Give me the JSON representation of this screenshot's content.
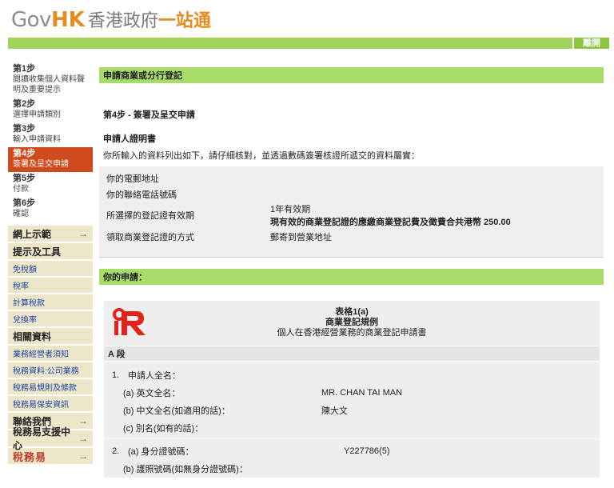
{
  "logo": {
    "gov": "Gov",
    "hk": "HK",
    "zh_part1": "香港政府",
    "zh_part2": "一站通"
  },
  "topbar": {
    "exit_label": "離開"
  },
  "steps": [
    {
      "title": "第1步",
      "desc": "閱讀收集個人資料聲明及重要提示"
    },
    {
      "title": "第2步",
      "desc": "選擇申請類別"
    },
    {
      "title": "第3步",
      "desc": "輸入申請資料"
    },
    {
      "title": "第4步",
      "desc": "簽署及呈交申請"
    },
    {
      "title": "第5步",
      "desc": "付款"
    },
    {
      "title": "第6步",
      "desc": "確認"
    }
  ],
  "side_menu": {
    "online_demo": "網上示範",
    "tips_tools": "提示及工具",
    "tips_links": [
      "免稅額",
      "稅率",
      "計算稅款",
      "兌換率"
    ],
    "related": "相關資料",
    "related_links": [
      "業務經營者須知",
      "稅務資料:公司業務",
      "稅務易規則及條款",
      "稅務易保安資訊"
    ],
    "contact": "聯絡我們",
    "support": "稅務易支援中心",
    "calligraphy": "稅務易",
    "arrow": "→"
  },
  "main": {
    "section_title": "申請商業或分行登記",
    "step_heading": "第4步 - 簽署及呈交申請",
    "declaration_heading": "申請人證明書",
    "intro_text": "你所輸入的資料列出如下，請仔細核對，並透過數碼簽署核證所遞交的資料屬實：",
    "summary": {
      "email_label": "你的電郵地址",
      "phone_label": "你的聯絡電話號碼",
      "validity_label": "所選擇的登記證有效期",
      "validity_value_line1": "1年有效期",
      "validity_value_line2": "現有效的商業登記證的應繳商業登記費及徵費合共港幣 250.00",
      "method_label": "領取商業登記證的方式",
      "method_value": "郵寄到營業地址"
    },
    "your_application": "你的申請："
  },
  "form": {
    "title1": "表格1(a)",
    "title2": "商業登記規例",
    "title3": "個人在香港經營業務的商業登記申請書",
    "section_a": "A 段",
    "q1_num": "1.",
    "q1_label": "申請人全名：",
    "q1a_label": "(a) 英文全名：",
    "q1a_value": "MR. CHAN TAI MAN",
    "q1b_label": "(b) 中文全名(如適用的話)：",
    "q1b_value": "陳大文",
    "q1c_label": "(c) 別名(如有的話)：",
    "q2_num": "2.",
    "q2a_label": "(a) 身分證號碼：",
    "q2a_value": "Y227786(5)",
    "q2b_label": "(b) 護照號碼(如無身分證號碼)："
  },
  "colors": {
    "green": "#a8dc6a",
    "orange": "#e88a1d",
    "active_step": "#cf4a1c",
    "ird_red": "#e2231a"
  }
}
